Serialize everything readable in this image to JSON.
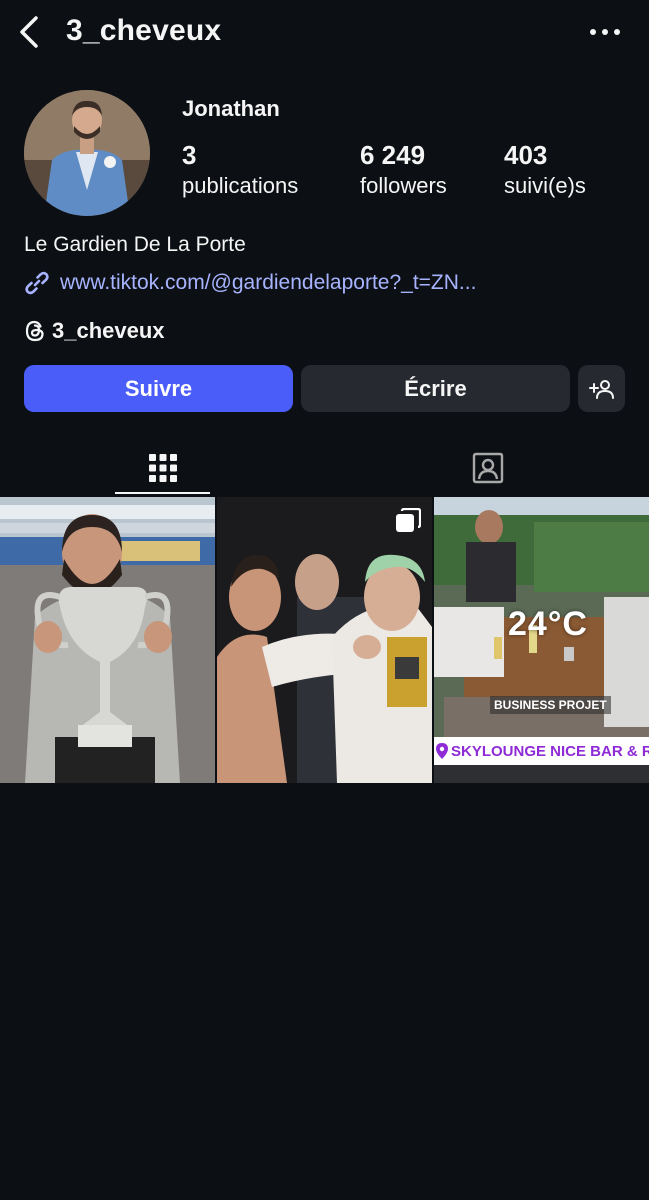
{
  "header": {
    "username": "3_cheveux",
    "back_icon": "chevron-left-icon",
    "more_icon": "more-horizontal-icon"
  },
  "profile": {
    "display_name": "Jonathan",
    "stats": {
      "posts": {
        "value": "3",
        "label": "publications"
      },
      "followers": {
        "value": "6 249",
        "label": "followers"
      },
      "following": {
        "value": "403",
        "label": "suivi(e)s"
      }
    },
    "bio": "Le Gardien De La Porte",
    "link": "www.tiktok.com/@gardiendelaporte?_t=ZN...",
    "threads_handle": "3_cheveux"
  },
  "actions": {
    "follow_label": "Suivre",
    "message_label": "Écrire",
    "suggest_icon": "add-person-icon"
  },
  "tabs": [
    {
      "name": "posts-grid",
      "icon": "grid-icon",
      "active": true
    },
    {
      "name": "tagged",
      "icon": "tagged-person-icon",
      "active": false
    }
  ],
  "posts": [
    {
      "description": "man-with-trophy"
    },
    {
      "description": "faceoff-photo",
      "multi": true
    },
    {
      "description": "rooftop-bar",
      "overlay_temp": "24°C",
      "overlay_tag": "BUSINESS PROJET",
      "overlay_location": "SKYLOUNGE NICE BAR & ROOFTOP"
    }
  ],
  "colors": {
    "background": "#0c1014",
    "follow_button": "#4a5df9",
    "secondary_button": "#262a30",
    "link": "#a7b3ff"
  }
}
